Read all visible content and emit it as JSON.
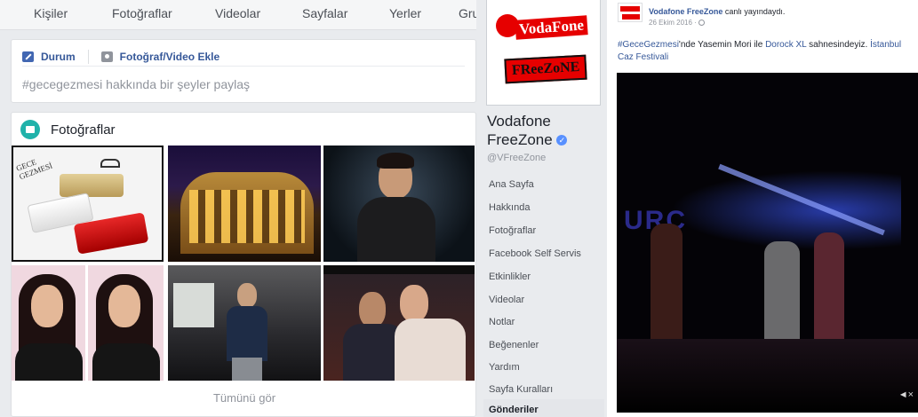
{
  "tabs": [
    "Kişiler",
    "Fotoğraflar",
    "Videolar",
    "Sayfalar",
    "Yerler",
    "Gru"
  ],
  "composer": {
    "status_label": "Durum",
    "photo_video_label": "Fotoğraf/Video Ekle",
    "placeholder": "#gecegezmesi hakkında bir şeyler paylaş"
  },
  "photos": {
    "title": "Fotoğraflar",
    "see_all": "Tümünü gör",
    "logo_text": "GECE GEZMESİ"
  },
  "page": {
    "logo_line1": "VodaFone",
    "logo_line2": "FReeZoNE",
    "name": "Vodafone FreeZone",
    "verified_mark": "✓",
    "handle": "@VFreeZone",
    "nav": [
      "Ana Sayfa",
      "Hakkında",
      "Fotoğraflar",
      "Facebook Self Servis",
      "Etkinlikler",
      "Videolar",
      "Notlar",
      "Beğenenler",
      "Yardım",
      "Sayfa Kuralları",
      "Gönderiler"
    ]
  },
  "post": {
    "author": "Vodafone FreeZone",
    "action": " canlı yayındaydı.",
    "date": "26 Ekim 2016 · ",
    "globe_icon": "globe-icon",
    "text_hashtag": "#GeceGezmesi",
    "text_1": "'nde Yasemin Mori ile ",
    "text_link1": "Dorock XL",
    "text_2": " sahnesindeyiz. ",
    "text_link2": "İstanbul Caz Festivali",
    "video_overlay_text": "URC",
    "mute_icon": "mute-icon"
  },
  "colors": {
    "brand_red": "#e60000",
    "fb_blue": "#365899",
    "verified": "#5890ff"
  }
}
